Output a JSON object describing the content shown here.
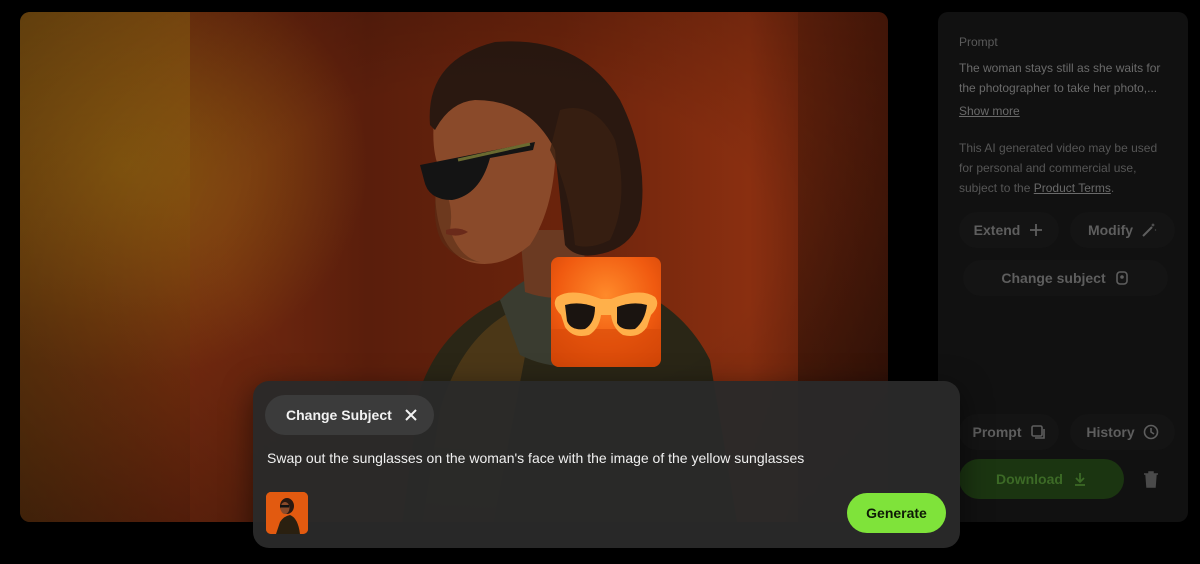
{
  "panel": {
    "prompt_label": "Prompt",
    "prompt_text": "The woman stays still as she waits for the photographer to take her photo,...",
    "show_more": "Show more",
    "license_text": "This AI generated video may be used for personal and commercial use, subject to the",
    "license_link": "Product Terms",
    "license_end": ".",
    "buttons": {
      "extend": "Extend",
      "modify": "Modify",
      "change_subject": "Change subject",
      "prompt": "Prompt",
      "history": "History",
      "download": "Download"
    }
  },
  "card": {
    "chip_label": "Change Subject",
    "input_value": "Swap out the sunglasses on the woman's face with the image of the yellow sunglasses",
    "generate": "Generate"
  },
  "colors": {
    "accent_green": "#7fe33a",
    "panel_bg": "#111111",
    "card_bg": "#2a2a2a"
  }
}
